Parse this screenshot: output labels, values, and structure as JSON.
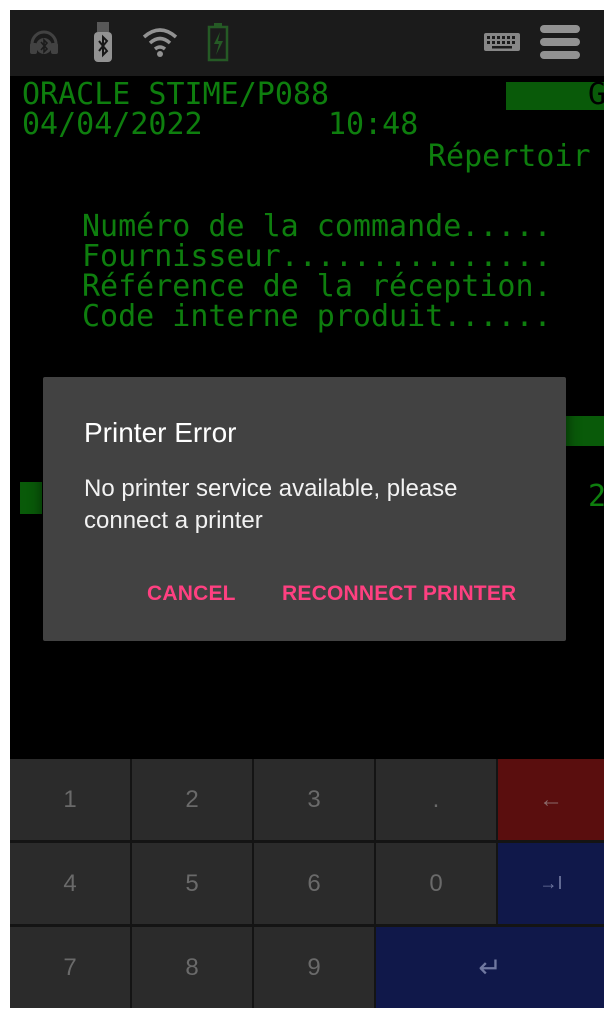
{
  "status_bar": {
    "icons": [
      "headset-bluetooth-icon",
      "bluetooth-device-icon",
      "wifi-icon",
      "battery-charging-icon",
      "keyboard-icon",
      "menu-icon"
    ]
  },
  "terminal": {
    "line1": "ORACLE STIME/P088",
    "line1_right": "G",
    "date": "04/04/2022",
    "time": "10:48",
    "title_partial": "Répertoir",
    "field1": "Numéro de la commande.....",
    "field2": "Fournisseur...............",
    "field3": "Référence de la réception.",
    "field4": "Code interne produit......",
    "right_char": "2",
    "text_color": "#16c216"
  },
  "dialog": {
    "title": "Printer Error",
    "message": "No printer service available, please connect a printer",
    "cancel_label": "CANCEL",
    "reconnect_label": "RECONNECT PRINTER",
    "accent_color": "#ff4081"
  },
  "keypad": {
    "row1": [
      "1",
      "2",
      "3",
      ".",
      "←"
    ],
    "row2": [
      "4",
      "5",
      "6",
      "0",
      "→I"
    ],
    "row3": [
      "7",
      "8",
      "9",
      "↵"
    ],
    "backspace_color": "#5a0e0e",
    "tab_color": "#10184a",
    "enter_color": "#10184a"
  }
}
